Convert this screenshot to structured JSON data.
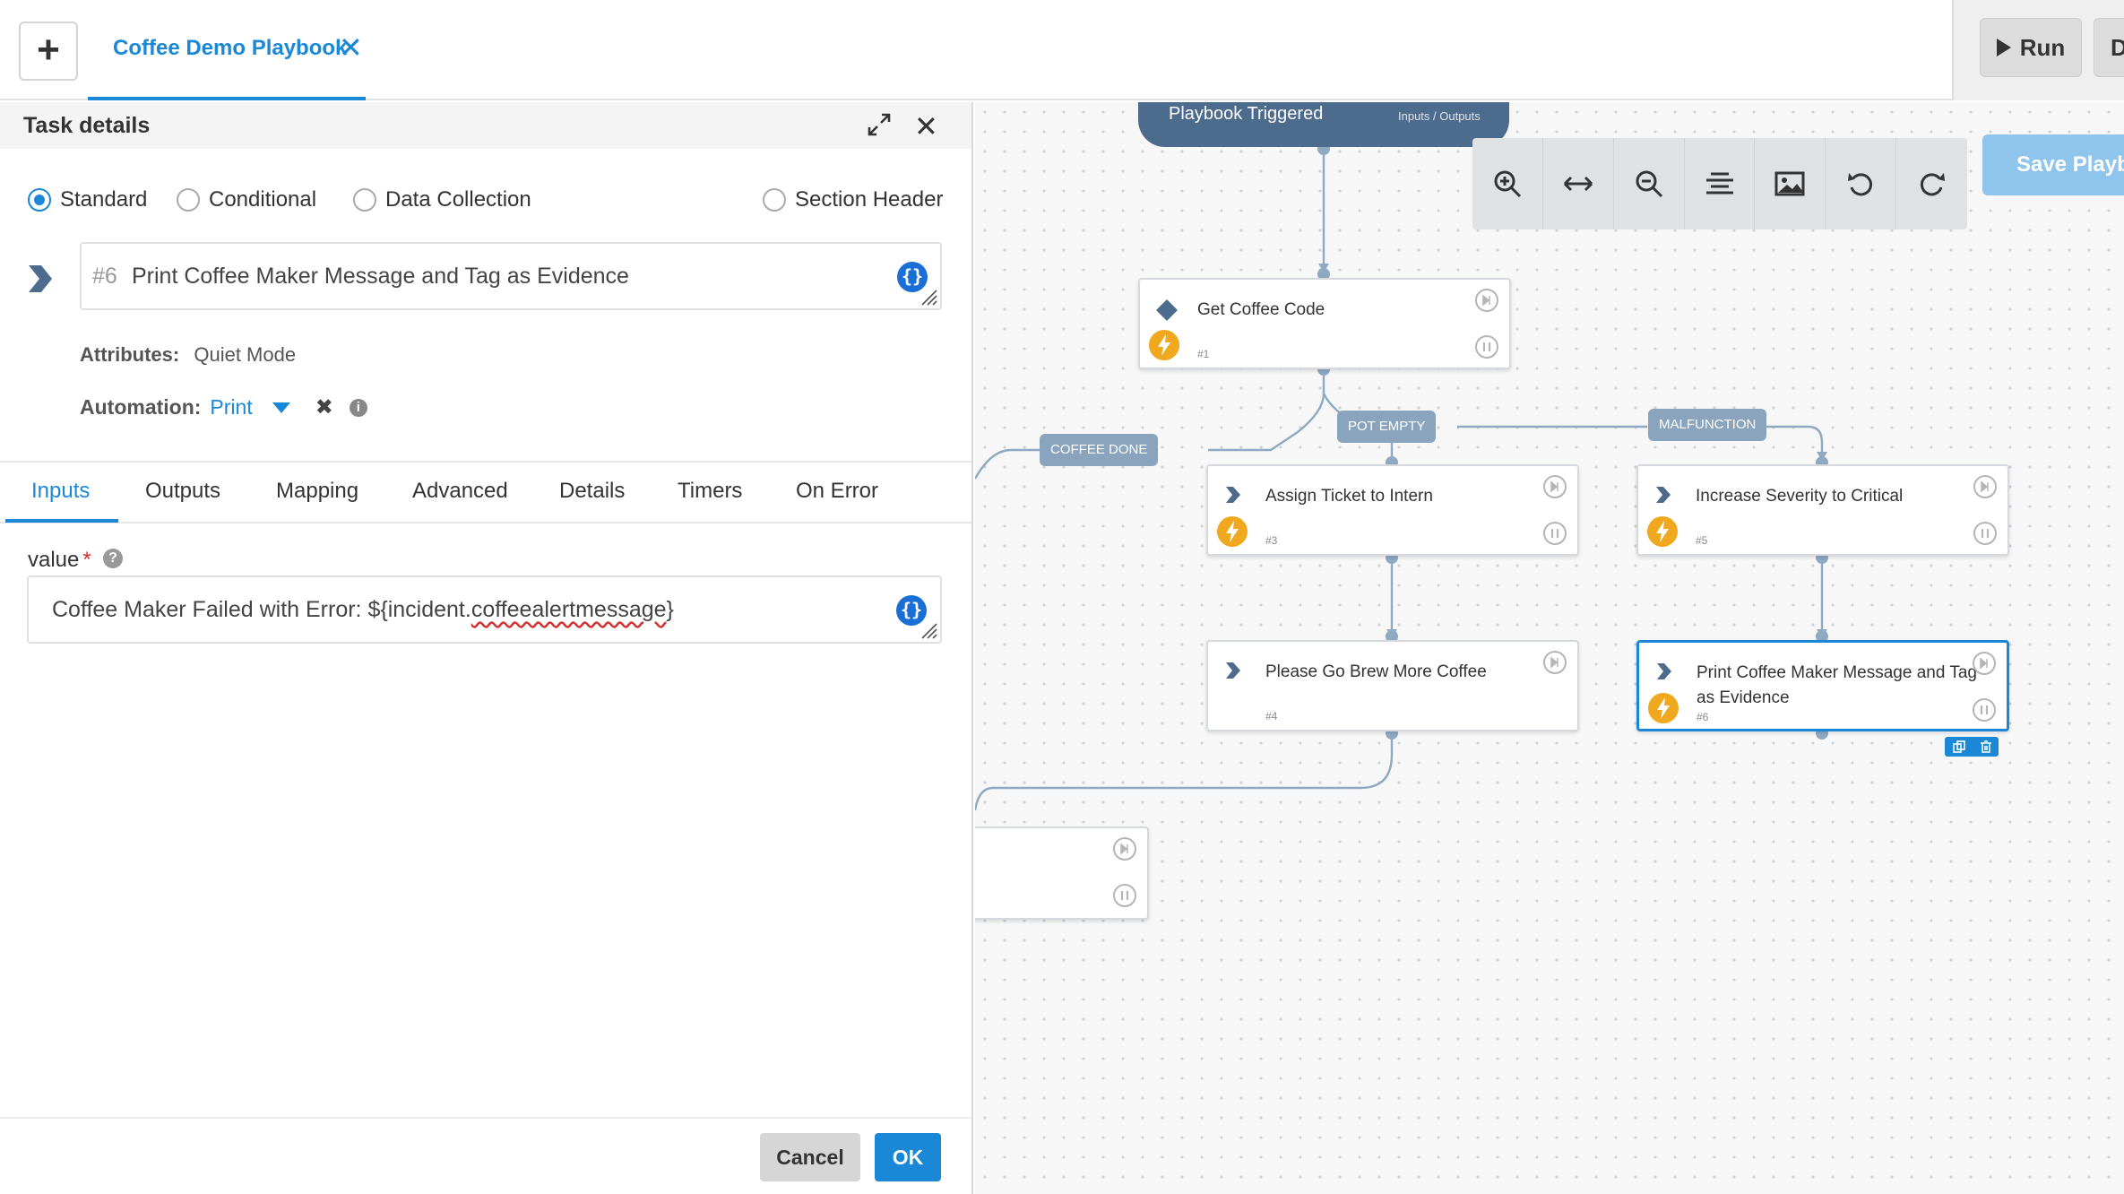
{
  "topbar": {
    "add_label": "+",
    "tab_title": "Coffee Demo Playbook",
    "tab_close": "✕",
    "run_label": "Run",
    "extra_label": "D"
  },
  "panel": {
    "title": "Task details",
    "close": "✕",
    "task_types": [
      {
        "label": "Standard",
        "checked": true
      },
      {
        "label": "Conditional",
        "checked": false
      },
      {
        "label": "Data Collection",
        "checked": false
      },
      {
        "label": "Section Header",
        "checked": false
      }
    ],
    "task_number": "#6",
    "task_name": "Print Coffee Maker Message and Tag as Evidence",
    "attributes_label": "Attributes:",
    "attributes_value": "Quiet Mode",
    "automation_label": "Automation:",
    "automation_value": "Print",
    "tabs": [
      "Inputs",
      "Outputs",
      "Mapping",
      "Advanced",
      "Details",
      "Timers",
      "On Error"
    ],
    "active_tab": "Inputs",
    "value_label": "value",
    "value_required": "*",
    "value_text_prefix": "Coffee Maker Failed with Error: ${incident.",
    "value_text_misspelled": "coffeealertmessage",
    "value_text_suffix": "}",
    "cancel_label": "Cancel",
    "ok_label": "OK"
  },
  "canvas": {
    "trigger_title": "Playbook Triggered",
    "trigger_sub": "Inputs / Outputs",
    "save_label": "Save Playbook",
    "toolbar_icons": [
      "zoom-in-icon",
      "fit-width-icon",
      "zoom-out-icon",
      "align-icon",
      "image-icon",
      "undo-icon",
      "redo-icon"
    ],
    "nodes": [
      {
        "id": "n1",
        "title": "Get Coffee Code",
        "num": "#1",
        "kind": "conditional"
      },
      {
        "id": "n3",
        "title": "Assign Ticket to Intern",
        "num": "#3",
        "kind": "standard"
      },
      {
        "id": "n5",
        "title": "Increase Severity to Critical",
        "num": "#5",
        "kind": "standard"
      },
      {
        "id": "n4",
        "title": "Please Go Brew More Coffee",
        "num": "#4",
        "kind": "manual"
      },
      {
        "id": "n6",
        "title": "Print Coffee Maker Message and Tag as Evidence",
        "num": "#6",
        "kind": "standard"
      }
    ],
    "conditions": [
      "COFFEE DONE",
      "POT EMPTY",
      "MALFUNCTION"
    ]
  }
}
